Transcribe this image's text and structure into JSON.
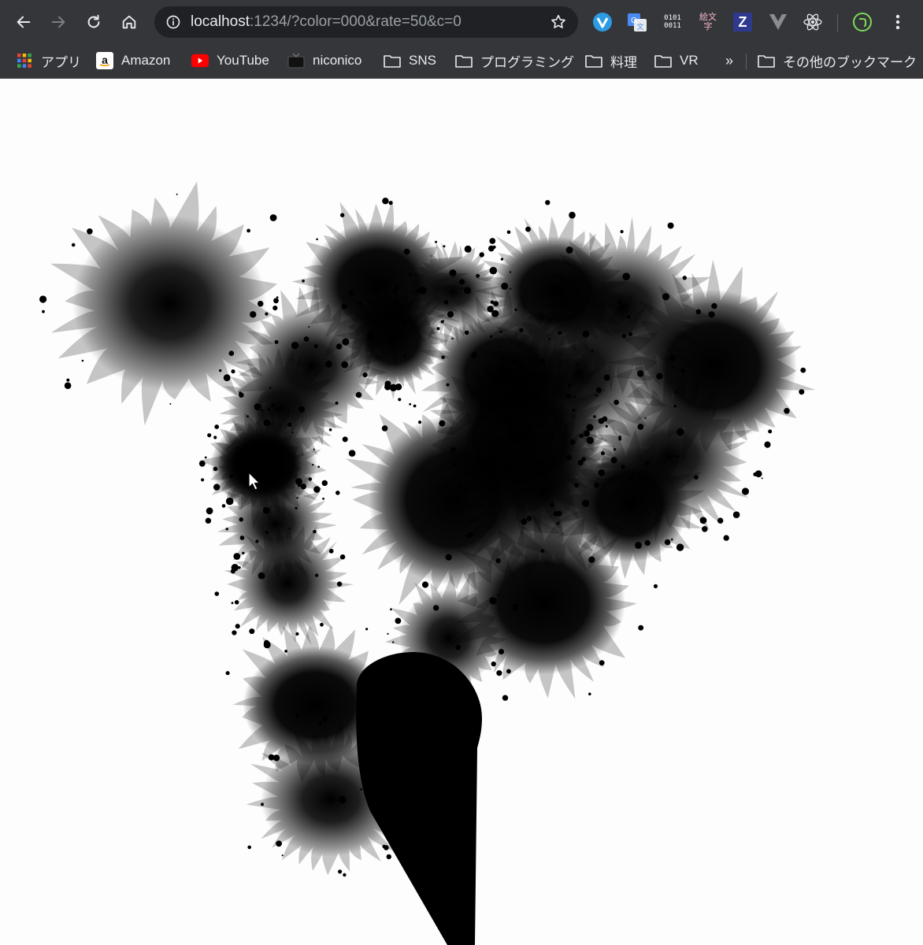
{
  "toolbar": {
    "url_host": "localhost",
    "url_rest": ":1234/?color=000&rate=50&c=0",
    "ext_binary": "0101\n0011",
    "ext_emoji": "絵文字",
    "ext_z": "Z"
  },
  "bookmarks": {
    "apps": "アプリ",
    "amazon": "Amazon",
    "youtube": "YouTube",
    "niconico": "niconico",
    "sns": "SNS",
    "programming": "プログラミング",
    "cooking": "料理",
    "vr": "VR",
    "more": "»",
    "other": "その他のブックマーク"
  },
  "canvas": {
    "ink_color": "#000000",
    "background": "#fdfdfd"
  }
}
